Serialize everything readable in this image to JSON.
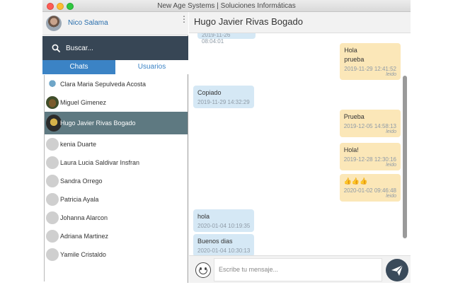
{
  "window": {
    "title": "New Age Systems | Soluciones Informáticas"
  },
  "profile": {
    "name": "Nico Salama"
  },
  "search": {
    "placeholder": "Buscar..."
  },
  "tabs": [
    {
      "label": "Chats",
      "active": true
    },
    {
      "label": "Usuarios",
      "active": false
    }
  ],
  "contacts": [
    {
      "name": "Clara Maria Sepulveda Acosta"
    },
    {
      "name": "Miguel Gimenez"
    },
    {
      "name": "Hugo Javier Rivas Bogado",
      "selected": true
    },
    {
      "name": "kenia Duarte"
    },
    {
      "name": "Laura Lucia Saldivar Insfran"
    },
    {
      "name": "Sandra Orrego"
    },
    {
      "name": "Patricia Ayala"
    },
    {
      "name": "Johanna Alarcon"
    },
    {
      "name": "Adriana Martinez"
    },
    {
      "name": "Yamile Cristaldo"
    }
  ],
  "chat": {
    "contact_name": "Hugo Javier Rivas Bogado",
    "partial_time": "2019-11-26 08:04:01",
    "messages": [
      {
        "dir": "out",
        "text_lines": [
          "Hola",
          "prueba"
        ],
        "time": "2019-11-29 12:41:52",
        "status": "leido"
      },
      {
        "dir": "in",
        "text_lines": [
          "Copiado"
        ],
        "time": "2019-11-29 14:32:29"
      },
      {
        "dir": "out",
        "text_lines": [
          "Prueba"
        ],
        "time": "2019-12-05 14:58:13",
        "status": "leido"
      },
      {
        "dir": "out",
        "text_lines": [
          "Hola!"
        ],
        "time": "2019-12-28 12:30:16",
        "status": "leido"
      },
      {
        "dir": "out",
        "text_lines": [
          "👍👍👍"
        ],
        "time": "2020-01-02 09:46:48",
        "status": "leido"
      },
      {
        "dir": "in",
        "text_lines": [
          "hola"
        ],
        "time": "2020-01-04 10:19:35"
      },
      {
        "dir": "in",
        "text_lines": [
          "Buenos dias"
        ],
        "time": "2020-01-04 10:30:13"
      }
    ],
    "composer_placeholder": "Escribe tu mensaje..."
  },
  "colors": {
    "accent": "#3b83c5",
    "search_bg": "#374655",
    "selected_row": "#5e7981",
    "bubble_in": "#d5e8f5",
    "bubble_out": "#fbe7b8"
  }
}
